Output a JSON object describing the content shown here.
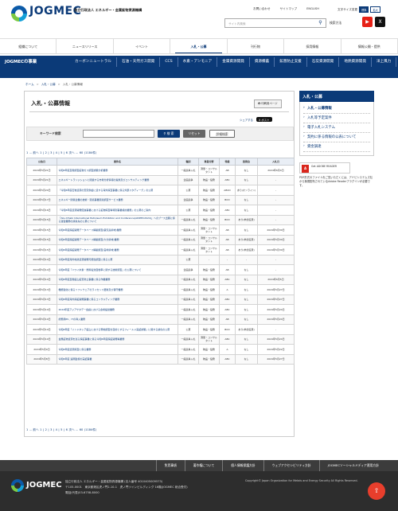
{
  "header": {
    "logo_text": "JOGMEC",
    "org_name": "独立行政法人 エネルギー・金属鉱物資源機構",
    "top_links": [
      "お問い合わせ",
      "サイトマップ",
      "ENGLISH"
    ],
    "fontsize_label": "文字サイズ変更",
    "fontsize_std": "標準",
    "fontsize_large": "拡大",
    "search_placeholder": "サイト内検索",
    "search_method": "検索方法",
    "youtube_icon": "youtube-icon",
    "x_icon": "x-icon"
  },
  "mainnav": [
    "組織について",
    "ニュースリリース",
    "イベント",
    "入札・公募",
    "刊行物",
    "採用情報",
    "情報公開・提供"
  ],
  "subnav": {
    "title": "JOGMECの事業",
    "items": [
      "カーボンニュートラル",
      "石油・天然ガス開発",
      "CCS",
      "水素・アンモニア",
      "金属資源開発",
      "資源備蓄",
      "鉱害防止支援",
      "石炭資源開発",
      "地熱資源開発",
      "洋上風力"
    ]
  },
  "breadcrumb": [
    "ホーム",
    "入札・公募",
    "入札・公募情報"
  ],
  "page": {
    "title": "入札・公募情報",
    "print_label": "印刷用ページ",
    "share_label": "シェアする",
    "post_label": "ポスト"
  },
  "keyword": {
    "label": "キーワード検索",
    "value": "",
    "search_btn": "検 索",
    "reset_btn": "リセット",
    "detail_btn": "詳細検索"
  },
  "pager": {
    "first": "1",
    "prefix": "... 前へ",
    "pages": [
      "1",
      "2",
      "3",
      "4",
      "5",
      "6"
    ],
    "suffix": "次へ ...",
    "last": "60",
    "total": "(1184件)"
  },
  "table": {
    "headers": [
      "公告日",
      "案件名",
      "種別",
      "事業分野",
      "等級",
      "質問会",
      "入札日"
    ],
    "rows": [
      [
        "2024年5月21日",
        "令和6年度直轄調査鉱物ガス調査試験分析業務",
        "一般競争入札",
        "測量・コンサルタント",
        "AB",
        "なし",
        "2024年6月4日"
      ],
      [
        "2024年5月21日",
        "エネルギートランジションに関連する市場分析情報の提供及びコンサルティング業務",
        "企画競争",
        "物品・役務",
        "ABC",
        "なし",
        "-"
      ],
      [
        "2024年5月20日",
        "「令和6年度石炭資源の安定供給に資する海外探査事業に係る外部スタディーグ」の公募",
        "公募",
        "物品・役務",
        "ABCD",
        "あり(オンライン)",
        "-"
      ],
      [
        "2024年5月17日",
        "エネルギー関係企業の技術・環境事業環境調査サービス業務",
        "企画競争",
        "物品・役務",
        "BCD",
        "なし",
        "-"
      ],
      [
        "2024年5月16日",
        "「令和6年度資源開発促進事業における鉱物探査等特別事業検討業務」の公募のご案内",
        "公募",
        "物品・役務",
        "ABC",
        "なし",
        "-"
      ],
      [
        "2024年5月15日",
        "「Abu Dhabi International Petroleum Exhibition and Conference(ADIPEC2024)」へのブース出展に係る運営業務の請負先の公募について",
        "一般競争入札",
        "物品・役務",
        "BCD",
        "あり(参加任意)",
        "-"
      ],
      [
        "2024年5月15日",
        "令和6年度探鉱開発データベース構築調査(鹿児島県域)業務",
        "一般競争入札",
        "測量・コンサルタント",
        "AB",
        "なし",
        "2024年5月30日"
      ],
      [
        "2024年5月15日",
        "令和6年度探鉱開発データベース構築調査(大分県域)業務",
        "一般競争入札",
        "測量・コンサルタント",
        "AB",
        "あり(参加任意)",
        "2024年5月30日"
      ],
      [
        "2024年5月15日",
        "令和6年度探鉱開発データベース構築調査(宮崎県域)業務",
        "一般競争入札",
        "測量・コンサルタント",
        "AB",
        "あり(参加任意)",
        "2024年5月30日"
      ],
      [
        "2024年5月14日",
        "令和6年度海外地熱資源開発可能性調査に係る公募",
        "公募",
        "-",
        "-",
        "-",
        "-"
      ],
      [
        "2024年5月14日",
        "令和6年度「ハワイ水素・燃料電池自動車に関する技術調査」の公募について",
        "企画競争",
        "物品・役務",
        "AB",
        "なし",
        "-"
      ],
      [
        "2024年5月14日",
        "令和6年度直轄鉱山鉱害防止事業に係る作業業務",
        "一般競争入札",
        "物品・役務",
        "ABC",
        "なし",
        "2024年6月5日"
      ],
      [
        "2024年5月13日",
        "機能強化に係るソフトウェアのライセンス更新及び保守業務",
        "一般競争入札",
        "物品・役務",
        "A",
        "なし",
        "2024年5月27日"
      ],
      [
        "2024年5月13日",
        "令和6年度海外探鉱開発事業に係るコンサルティング業務",
        "一般競争入札",
        "物品・役務",
        "ABC",
        "なし",
        "2024年5月27日"
      ],
      [
        "2024年5月10日",
        "2024年度アジアサタデー会議における会場設営業務",
        "一般競争入札",
        "物品・役務",
        "ABC",
        "なし",
        "2024年5月24日"
      ],
      [
        "2024年5月10日",
        "総務用PC、ITの導入業務",
        "一般競争入札",
        "物品・役務",
        "AB",
        "なし",
        "2024年5月24日"
      ],
      [
        "2024年5月10日",
        "令和6年度「インドネシア鉱山における現地調査を目的とするフィールド実証試験」に関する請負の公募",
        "公募",
        "物品・役務",
        "BCD",
        "あり(参加任意)",
        "-"
      ],
      [
        "2024年5月10日",
        "金属鉱物資源を巡る探鉱事業に係る令和6年度探鉱開発等業務",
        "一般競争入札",
        "測量・コンサルタント",
        "ABC",
        "なし",
        "2024年5月24日"
      ],
      [
        "2024年5月9日",
        "令和6年度資源探査に係る業務",
        "一般競争入札",
        "物品・役務",
        "A",
        "なし",
        "2024年5月22日"
      ],
      [
        "2024年5月8日",
        "令和6年度 遠隔監視の実証事業",
        "一般競争入札",
        "物品・役務",
        "ABC",
        "なし",
        "2024年5月27日"
      ]
    ]
  },
  "sidebar": {
    "head": "入札・公募",
    "items": [
      "入札・公募情報",
      "入札等予定案件",
      "電子入札システム",
      "契約に係る情報の公表について",
      "資金調達"
    ],
    "adobe_label": "Get ADOBE READER",
    "adobe_note": "PDF形式のファイルをご覧いただくには、アドビシステムズ社から無償配布されているAdobe Readerプラグインが必要です。"
  },
  "footer": {
    "links": [
      "免責事項",
      "著作権について",
      "個人情報保護方針",
      "ウェブアクセシビリティ方針",
      "JOGMECソーシャルメディア運用方針"
    ],
    "logo_text": "JOGMEC",
    "info_lines": [
      "独立行政法人 エネルギー・金属鉱物資源機構 (法人番号 4010405009573)",
      "〒105-0001　東京都港区虎ノ門2-10-1　虎ノ門ツインビルディング 16階(JOGMEC 総合受付)",
      "電話(代表)03-6758-8000"
    ],
    "copyright": "Copyright© Japan Organization for Metals and Energy Security All Rights Reserved.",
    "pagetop_icon": "arrow-up-icon"
  }
}
